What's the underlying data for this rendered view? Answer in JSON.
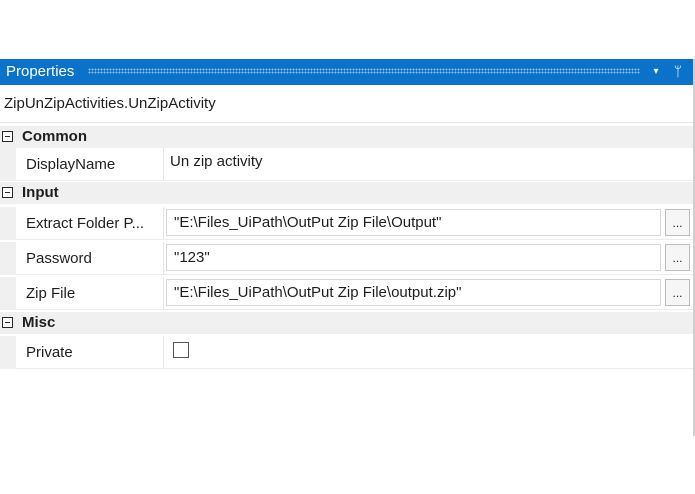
{
  "panel": {
    "title": "Properties",
    "dropdown_icon": "▾",
    "pin_icon": "ᛘ",
    "activity_type": "ZipUnZipActivities.UnZipActivity"
  },
  "categories": {
    "common": {
      "label": "Common",
      "properties": {
        "display_name": {
          "name": "DisplayName",
          "value": "Un zip activity"
        }
      }
    },
    "input": {
      "label": "Input",
      "properties": {
        "extract_folder": {
          "name": "Extract Folder P...",
          "value": "\"E:\\Files_UiPath\\OutPut Zip File\\Output\"",
          "button": "..."
        },
        "password": {
          "name": "Password",
          "value": "\"123\"",
          "button": "..."
        },
        "zip_file": {
          "name": "Zip File",
          "value": "\"E:\\Files_UiPath\\OutPut Zip File\\output.zip\"",
          "button": "..."
        }
      }
    },
    "misc": {
      "label": "Misc",
      "properties": {
        "private": {
          "name": "Private",
          "checked": false
        }
      }
    }
  },
  "colors": {
    "title_bar": "#0a72c8",
    "category_bg": "#f0f0f0"
  }
}
